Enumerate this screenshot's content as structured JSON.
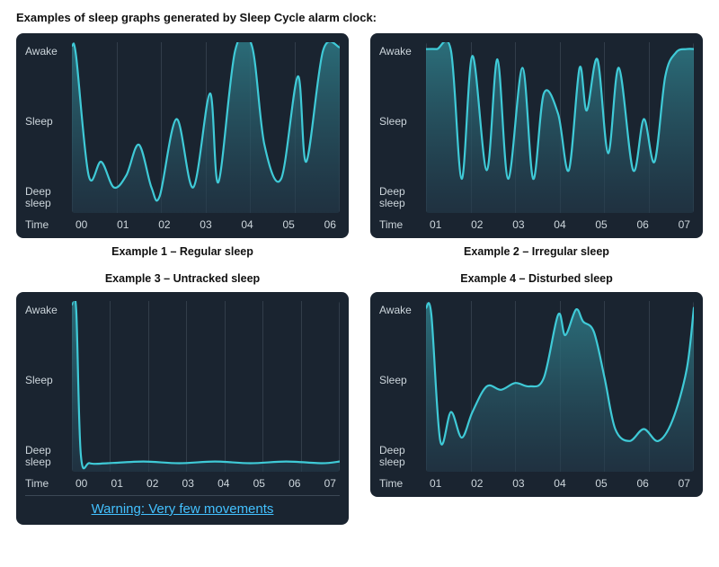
{
  "page_title": "Examples of sleep graphs generated by Sleep Cycle alarm clock:",
  "y_ticks": [
    "Awake",
    "Sleep",
    "Deep\nsleep"
  ],
  "x_label": "Time",
  "captions": {
    "ex1": "Example 1 – Regular sleep",
    "ex2": "Example 2 – Irregular sleep",
    "ex3": "Example 3 – Untracked sleep",
    "ex4": "Example 4 – Disturbed sleep"
  },
  "warning_text": "Warning: Very few movements",
  "colors": {
    "card_bg": "#1a2430",
    "line": "#3fcad7",
    "fill_top": "#2e7c88",
    "fill_bottom": "#233a4b",
    "text": "#cdd6dc",
    "warning": "#43c1ff"
  },
  "chart_data": [
    {
      "id": "ex1",
      "type": "area",
      "title": "Example 1 – Regular sleep",
      "xlabel": "Time",
      "ylabel_ticks": [
        "Deep sleep",
        "Sleep",
        "Awake"
      ],
      "ylim": [
        0,
        100
      ],
      "x_ticks": [
        "00",
        "01",
        "02",
        "03",
        "04",
        "05",
        "06"
      ],
      "series": [
        {
          "name": "sleep-level",
          "x": [
            0.0,
            0.1,
            0.4,
            0.7,
            1.0,
            1.3,
            1.6,
            1.9,
            2.1,
            2.5,
            2.9,
            3.3,
            3.5,
            3.9,
            4.3,
            4.6,
            5.0,
            5.4,
            5.6,
            6.0,
            6.4
          ],
          "values": [
            98,
            92,
            22,
            30,
            15,
            22,
            40,
            15,
            10,
            55,
            15,
            70,
            18,
            95,
            98,
            40,
            20,
            80,
            30,
            95,
            97
          ]
        }
      ]
    },
    {
      "id": "ex2",
      "type": "area",
      "title": "Example 2 – Irregular sleep",
      "xlabel": "Time",
      "ylabel_ticks": [
        "Deep sleep",
        "Sleep",
        "Awake"
      ],
      "ylim": [
        0,
        100
      ],
      "x_ticks": [
        "01",
        "02",
        "03",
        "04",
        "05",
        "06",
        "07"
      ],
      "series": [
        {
          "name": "sleep-level",
          "x": [
            0.0,
            0.3,
            0.7,
            1.0,
            1.3,
            1.7,
            2.0,
            2.3,
            2.7,
            3.0,
            3.3,
            3.7,
            4.0,
            4.3,
            4.5,
            4.8,
            5.1,
            5.4,
            5.8,
            6.1,
            6.4,
            6.7,
            7.0,
            7.3,
            7.5
          ],
          "values": [
            96,
            96,
            95,
            20,
            92,
            25,
            90,
            20,
            85,
            20,
            70,
            58,
            25,
            85,
            60,
            90,
            35,
            85,
            25,
            55,
            30,
            80,
            94,
            96,
            96
          ]
        }
      ]
    },
    {
      "id": "ex3",
      "type": "area",
      "title": "Example 3 – Untracked sleep",
      "xlabel": "Time",
      "ylabel_ticks": [
        "Deep sleep",
        "Sleep",
        "Awake"
      ],
      "ylim": [
        0,
        100
      ],
      "x_ticks": [
        "00",
        "01",
        "02",
        "03",
        "04",
        "05",
        "06",
        "07"
      ],
      "warning": "Warning: Very few movements",
      "series": [
        {
          "name": "sleep-level",
          "x": [
            0.0,
            0.12,
            0.25,
            0.5,
            1.0,
            2.0,
            3.0,
            4.0,
            5.0,
            6.0,
            7.0,
            7.5
          ],
          "values": [
            98,
            95,
            10,
            5,
            5,
            6,
            5,
            6,
            5,
            6,
            5,
            6
          ]
        }
      ]
    },
    {
      "id": "ex4",
      "type": "area",
      "title": "Example 4 – Disturbed sleep",
      "xlabel": "Time",
      "ylabel_ticks": [
        "Deep sleep",
        "Sleep",
        "Awake"
      ],
      "ylim": [
        0,
        100
      ],
      "x_ticks": [
        "01",
        "02",
        "03",
        "04",
        "05",
        "06",
        "07"
      ],
      "series": [
        {
          "name": "sleep-level",
          "x": [
            0.0,
            0.15,
            0.4,
            0.7,
            1.0,
            1.3,
            1.7,
            2.1,
            2.5,
            2.9,
            3.3,
            3.7,
            3.9,
            4.2,
            4.4,
            4.7,
            5.0,
            5.3,
            5.7,
            6.1,
            6.5,
            6.9,
            7.3,
            7.5
          ],
          "values": [
            96,
            92,
            18,
            35,
            20,
            35,
            50,
            48,
            52,
            50,
            55,
            92,
            80,
            95,
            88,
            82,
            55,
            25,
            18,
            25,
            18,
            30,
            60,
            96
          ]
        }
      ]
    }
  ]
}
